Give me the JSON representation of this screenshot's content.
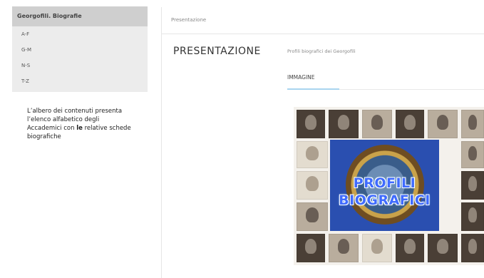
{
  "tree": {
    "title": "Georgofili. Biografie",
    "items": [
      {
        "label": "A-F"
      },
      {
        "label": "G-M"
      },
      {
        "label": "N-S"
      },
      {
        "label": "T-Z"
      }
    ]
  },
  "note": {
    "text_before": "L’albero dei contenuti presenta l’elenco alfabetico degli Accademici con ",
    "bold": "le",
    "text_after": " relative schede biografiche"
  },
  "main": {
    "breadcrumb": "Presentazione",
    "title": "PRESENTAZIONE",
    "subtitle": "Profili biografici dei Georgofili",
    "tab": "IMMAGINE"
  },
  "image": {
    "banner_line1": "PROFILI",
    "banner_line2": "BIOGRAFICI"
  }
}
